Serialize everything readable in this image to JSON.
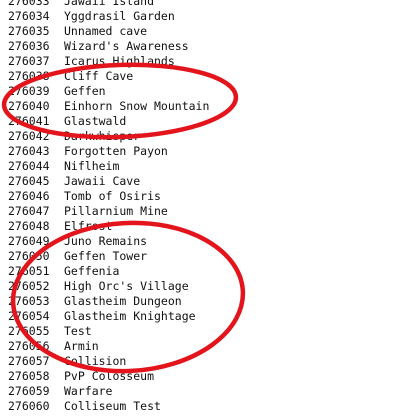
{
  "rows": [
    {
      "id": "276033",
      "name": "Jawaii Island"
    },
    {
      "id": "276034",
      "name": "Yggdrasil Garden"
    },
    {
      "id": "276035",
      "name": "Unnamed cave"
    },
    {
      "id": "276036",
      "name": "Wizard's Awareness"
    },
    {
      "id": "276037",
      "name": "Icarus Highlands"
    },
    {
      "id": "276038",
      "name": "Cliff Cave"
    },
    {
      "id": "276039",
      "name": "Geffen"
    },
    {
      "id": "276040",
      "name": "Einhorn Snow Mountain"
    },
    {
      "id": "276041",
      "name": "Glastwald"
    },
    {
      "id": "276042",
      "name": "Darkwhisper"
    },
    {
      "id": "276043",
      "name": "Forgotten Payon"
    },
    {
      "id": "276044",
      "name": "Niflheim"
    },
    {
      "id": "276045",
      "name": "Jawaii Cave"
    },
    {
      "id": "276046",
      "name": "Tomb of Osiris"
    },
    {
      "id": "276047",
      "name": "Pillarnium Mine"
    },
    {
      "id": "276048",
      "name": "Elfrost"
    },
    {
      "id": "276049",
      "name": "Juno Remains"
    },
    {
      "id": "276050",
      "name": "Geffen Tower"
    },
    {
      "id": "276051",
      "name": "Geffenia"
    },
    {
      "id": "276052",
      "name": "High Orc's Village"
    },
    {
      "id": "276053",
      "name": "Glastheim Dungeon"
    },
    {
      "id": "276054",
      "name": "Glastheim Knightage"
    },
    {
      "id": "276055",
      "name": "Test"
    },
    {
      "id": "276056",
      "name": "Armin"
    },
    {
      "id": "276057",
      "name": "Collision"
    },
    {
      "id": "276058",
      "name": "PvP Colosseum"
    },
    {
      "id": "276059",
      "name": "Warfare"
    },
    {
      "id": "276060",
      "name": "Colliseum Test"
    }
  ],
  "annotation_color": "#e3141c"
}
